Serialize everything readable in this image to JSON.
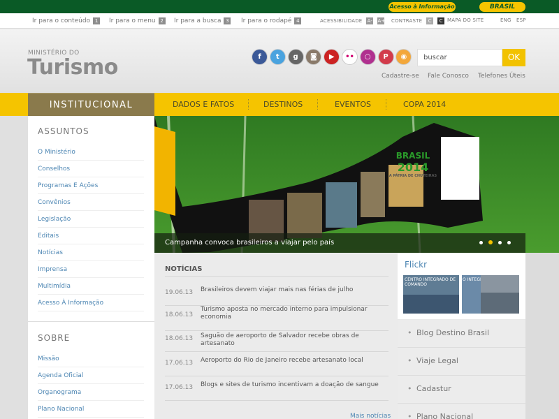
{
  "topbar": {
    "access_label": "Acesso à Informação",
    "brasil_label": "BRASIL"
  },
  "accessibility": {
    "skip_links": [
      {
        "label": "Ir para o conteúdo",
        "key": "1"
      },
      {
        "label": "Ir para o menu",
        "key": "2"
      },
      {
        "label": "Ir para a busca",
        "key": "3"
      },
      {
        "label": "Ir para o rodapé",
        "key": "4"
      }
    ],
    "acessibilidade_label": "ACESSIBILIDADE",
    "font_minus": "A-",
    "font_plus": "A+",
    "contraste_label": "CONTRASTE",
    "contrast_c1": "C",
    "contrast_c2": "C",
    "mapa_label": "MAPA DO SITE",
    "lang_en": "ENG",
    "lang_es": "ESP"
  },
  "logo": {
    "small": "MINISTÉRIO DO",
    "big": "Turismo"
  },
  "social": [
    {
      "icon": "facebook-icon",
      "glyph": "f",
      "color": "#3b5998"
    },
    {
      "icon": "twitter-icon",
      "glyph": "t",
      "color": "#4aa3df"
    },
    {
      "icon": "googleplus-icon",
      "glyph": "g",
      "color": "#666666"
    },
    {
      "icon": "instagram-icon",
      "glyph": "◙",
      "color": "#8a7a6a"
    },
    {
      "icon": "youtube-icon",
      "glyph": "▶",
      "color": "#cc2222"
    },
    {
      "icon": "flickr-icon",
      "glyph": "••",
      "color": "#ffffff"
    },
    {
      "icon": "orkut-icon",
      "glyph": "○",
      "color": "#b0308f"
    },
    {
      "icon": "pinterest-icon",
      "glyph": "P",
      "color": "#d23b4b"
    },
    {
      "icon": "rss-icon",
      "glyph": "◉",
      "color": "#f3a73a"
    }
  ],
  "search": {
    "value": "buscar",
    "button": "OK"
  },
  "header_links": [
    "Cadastre-se",
    "Fale Conosco",
    "Telefones Úteis"
  ],
  "nav": {
    "active": "INSTITUCIONAL",
    "tabs": [
      "DADOS E FATOS",
      "DESTINOS",
      "EVENTOS",
      "COPA 2014"
    ]
  },
  "sidebar": {
    "assuntos_title": "ASSUNTOS",
    "assuntos": [
      "O Ministério",
      "Conselhos",
      "Programas E Ações",
      "Convênios",
      "Legislação",
      "Editais",
      "Notícias",
      "Imprensa",
      "Multimídia",
      "Acesso À Informação"
    ],
    "sobre_title": "SOBRE",
    "sobre": [
      "Missão",
      "Agenda Oficial",
      "Organograma",
      "Plano Nacional"
    ]
  },
  "banner": {
    "caption": "Campanha convoca brasileiros a viajar pelo país",
    "logo_line1": "BRASIL",
    "logo_line2": "2014",
    "logo_tagline": "A PÁTRIA DE CHUTEIRAS"
  },
  "news": {
    "title": "NOTÍCIAS",
    "items": [
      {
        "date": "19.06.13",
        "title": "Brasileiros devem viajar mais nas férias de julho"
      },
      {
        "date": "18.06.13",
        "title": "Turismo aposta no mercado interno para impulsionar economia"
      },
      {
        "date": "18.06.13",
        "title": "Saguão de aeroporto de Salvador recebe obras de artesanato"
      },
      {
        "date": "17.06.13",
        "title": "Aeroporto do Rio de Janeiro recebe artesanato local"
      },
      {
        "date": "17.06.13",
        "title": "Blogs e sites de turismo incentivam a doação de sangue"
      }
    ],
    "more": "Mais notícias"
  },
  "flickr": {
    "title": "Flickr",
    "photo1_text": "CENTRO INTEGRADO DE COMANDO",
    "photo2_text": "O INTEGRADO CONTR"
  },
  "right_list": [
    "Blog Destino Brasil",
    "Viaje Legal",
    "Cadastur",
    "Plano Nacional"
  ]
}
